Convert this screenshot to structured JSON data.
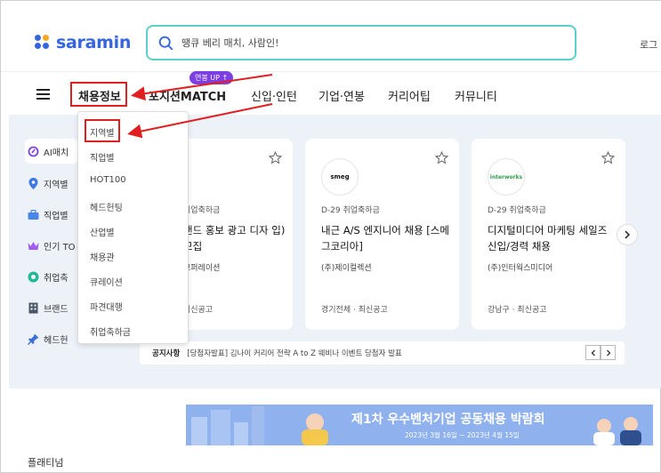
{
  "header": {
    "logo_text": "saramin",
    "search_placeholder": "땡큐 베리 매치, 사람인!",
    "login_label": "로그"
  },
  "nav": {
    "items": [
      "채용정보",
      "포지션MATCH",
      "신입·인턴",
      "기업·연봉",
      "커리어팁",
      "커뮤니티"
    ],
    "badge": "연봉 UP ↑"
  },
  "dropdown": {
    "items": [
      "지역별",
      "직업별",
      "HOT100",
      "헤드헌팅",
      "산업별",
      "채용관",
      "큐레이션",
      "파견대행",
      "취업축하금"
    ]
  },
  "sidebar": {
    "items": [
      "AI매치",
      "지역별",
      "직업별",
      "인기 TO",
      "취업축",
      "브랜드",
      "헤드헌"
    ]
  },
  "cards": [
    {
      "logo": "",
      "meta": "취업축하금",
      "title": "랜드 홍보 광고 디자 입) 모집",
      "company": "코퍼레이션",
      "loc": "최신공고"
    },
    {
      "logo": "smeg",
      "meta": "D-29  취업축하금",
      "title": "내근 A/S 엔지니어 채용 [스메그코리아]",
      "company": "(주)제이컬렉션",
      "loc": "경기전체 · 최신공고"
    },
    {
      "logo": "interworks",
      "meta": "D-29  취업축하금",
      "title": "디지털미디어 마케팅 세일즈 신입/경력 채용",
      "company": "(주)인터웍스미디어",
      "loc": "강남구 · 최신공고"
    }
  ],
  "notice": {
    "label": "공지사항",
    "text": "[당첨자발표] 김나이 커리어 전략 A to Z 웨비나 이벤트 당첨자 발표"
  },
  "banner": {
    "title": "제1차 우수벤처기업 공동채용 박람회",
    "date": "2023년 3월 16일 ~ 2023년 4월 15일"
  },
  "footer": {
    "section": "플래티넘"
  },
  "colors": {
    "brand": "#3566e0",
    "search_border": "#5ad1c8",
    "annotation": "#e02020",
    "badge": "#7b3fe4"
  }
}
